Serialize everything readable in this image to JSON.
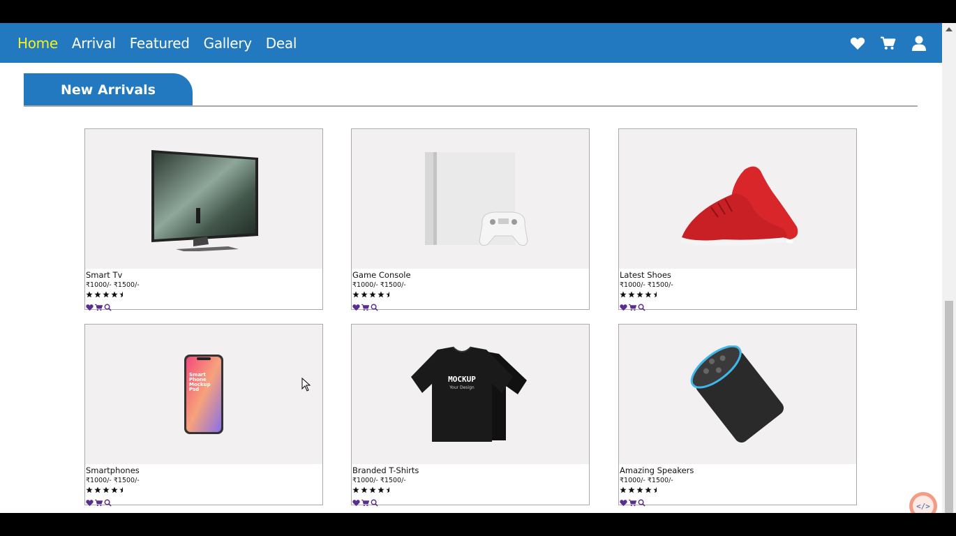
{
  "nav": {
    "links": [
      {
        "label": "Home",
        "active": true
      },
      {
        "label": "Arrival"
      },
      {
        "label": "Featured"
      },
      {
        "label": "Gallery"
      },
      {
        "label": "Deal"
      }
    ],
    "icons": [
      "heart-icon",
      "cart-icon",
      "user-icon"
    ]
  },
  "section": {
    "title": "New Arrivals"
  },
  "products": [
    {
      "name": "Smart Tv",
      "price": "₹1000/- ₹1500/-",
      "rating": 4.5,
      "image": "monitor"
    },
    {
      "name": "Game Console",
      "price": "₹1000/- ₹1500/-",
      "rating": 4.5,
      "image": "console"
    },
    {
      "name": "Latest Shoes",
      "price": "₹1000/- ₹1500/-",
      "rating": 4.5,
      "image": "shoes"
    },
    {
      "name": "Smartphones",
      "price": "₹1000/- ₹1500/-",
      "rating": 4.5,
      "image": "phone",
      "image_text": "Smart Phone Mockup Psd"
    },
    {
      "name": "Branded T-Shirts",
      "price": "₹1000/- ₹1500/-",
      "rating": 4.5,
      "image": "tshirt",
      "image_text": "MOCKUP",
      "image_subtext": "Your Design"
    },
    {
      "name": "Amazing Speakers",
      "price": "₹1000/- ₹1500/-",
      "rating": 4.5,
      "image": "speaker"
    }
  ],
  "fab": {
    "label": "</>"
  },
  "colors": {
    "brand": "#2279bf",
    "active_nav": "#f4f21a",
    "action_icons": "#5a2d91"
  }
}
